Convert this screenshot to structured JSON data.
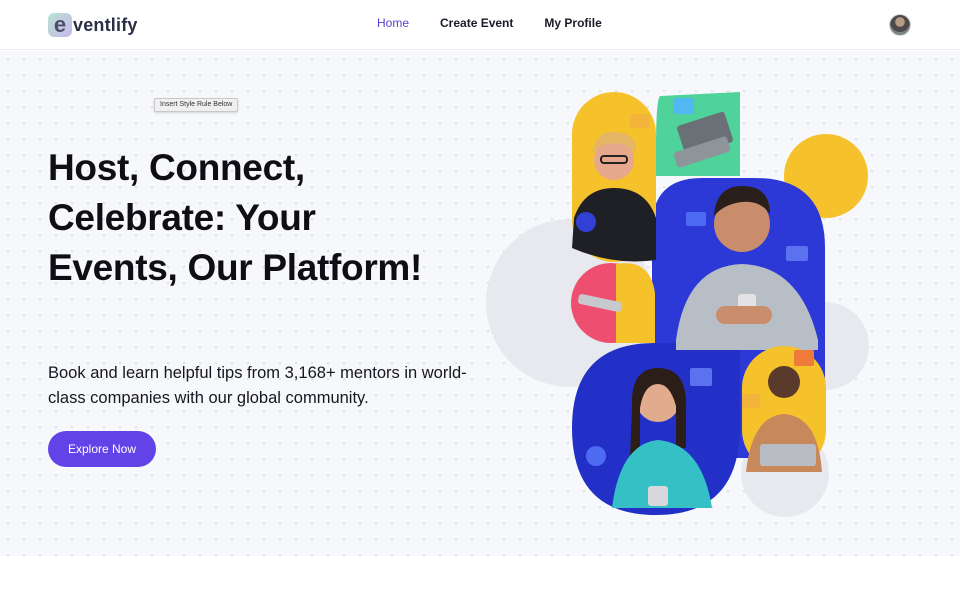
{
  "nav": {
    "logo_letter": "e",
    "logo_text": "ventlify",
    "links": [
      {
        "label": "Home",
        "active": true
      },
      {
        "label": "Create Event",
        "active": false
      },
      {
        "label": "My Profile",
        "active": false
      }
    ]
  },
  "hero": {
    "tooltip": "Insert Style Rule Below",
    "headline": "Host, Connect, Celebrate: Your Events, Our Platform!",
    "subtext": "Book and learn helpful tips from 3,168+ mentors in world-class companies with our global community.",
    "cta_label": "Explore Now"
  },
  "colors": {
    "accent": "#6143e7",
    "active_link": "#5b3fd6",
    "blue": "#2c39d6",
    "yellow": "#f6c22c",
    "green": "#4fd39a",
    "pink": "#ef4f6f"
  }
}
